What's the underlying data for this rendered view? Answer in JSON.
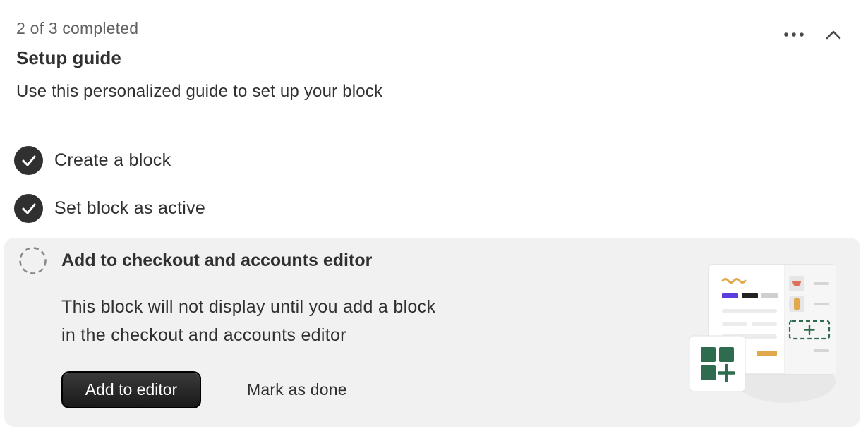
{
  "header": {
    "progress_text": "2 of 3 completed",
    "title": "Setup guide",
    "subtitle": "Use this personalized guide to set up your block",
    "more_icon": "more-horizontal-icon",
    "collapse_icon": "chevron-up-icon"
  },
  "steps": [
    {
      "label": "Create a block",
      "status": "completed"
    },
    {
      "label": "Set block as active",
      "status": "completed"
    },
    {
      "label": "Add to checkout and accounts editor",
      "status": "incomplete",
      "description_line1": "This block will not display until you add a block",
      "description_line2": "in the checkout and accounts editor",
      "primary_action": "Add to editor",
      "secondary_action": "Mark as done"
    }
  ],
  "colors": {
    "text": "#303030",
    "muted": "#616161",
    "active_bg": "#f1f1f1",
    "primary_button": "#303030",
    "accent_green": "#2e6b4f",
    "accent_orange": "#e0a84a",
    "accent_purple": "#5b3ce0"
  }
}
